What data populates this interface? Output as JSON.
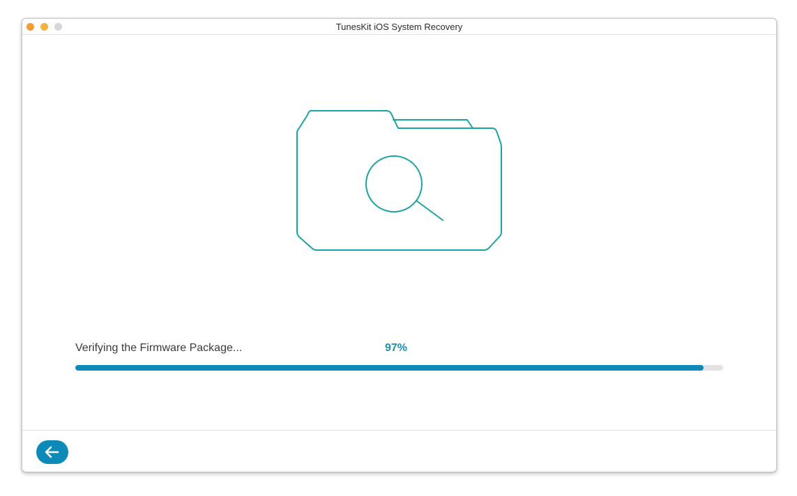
{
  "window": {
    "title": "TunesKit iOS System Recovery"
  },
  "controls": {
    "close_color": "#f09c38",
    "minimize_color": "#f5b042",
    "zoom_color": "#d6d6d6"
  },
  "illustration": {
    "icon": "folder-search-icon",
    "stroke_color": "#1aa3a3"
  },
  "progress": {
    "label": "Verifying the Firmware Package...",
    "percent_text": "97%",
    "value": 97,
    "fill_color": "#0d8ab8",
    "track_color": "#e2e2e2",
    "text_color": "#1a8fb0"
  },
  "footer": {
    "back_icon": "arrow-left-icon",
    "back_color": "#0d8ab8"
  }
}
